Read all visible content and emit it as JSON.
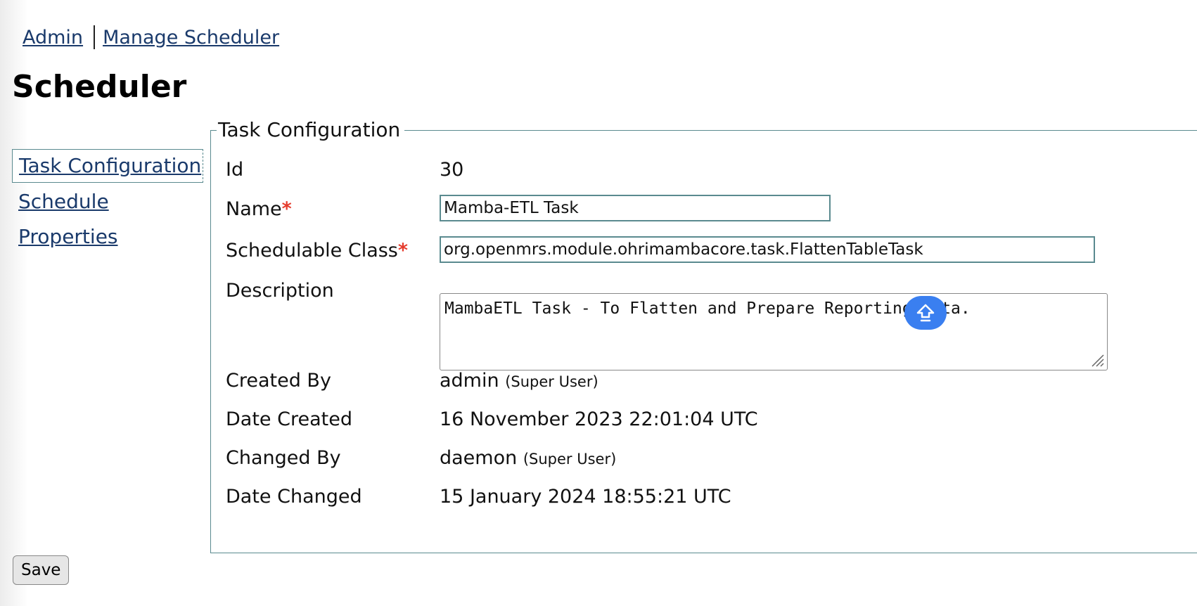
{
  "breadcrumb": {
    "admin": "Admin",
    "manage_scheduler": "Manage Scheduler"
  },
  "page": {
    "title": "Scheduler"
  },
  "side_nav": {
    "items": [
      {
        "label": "Task Configuration",
        "active": true
      },
      {
        "label": "Schedule",
        "active": false
      },
      {
        "label": "Properties",
        "active": false
      }
    ]
  },
  "panel": {
    "legend": "Task Configuration",
    "required_marker": "*",
    "id": {
      "label": "Id",
      "value": "30"
    },
    "name": {
      "label": "Name",
      "value": "Mamba-ETL Task"
    },
    "schedulable_class": {
      "label": "Schedulable Class",
      "value": "org.openmrs.module.ohrimambacore.task.FlattenTableTask"
    },
    "description": {
      "label": "Description",
      "value": "MambaETL Task - To Flatten and Prepare Reporting Data."
    },
    "created_by": {
      "label": "Created By",
      "value": "admin",
      "role": "(Super User)"
    },
    "date_created": {
      "label": "Date Created",
      "value": "16 November 2023 22:01:04 UTC"
    },
    "changed_by": {
      "label": "Changed By",
      "value": "daemon",
      "role": "(Super User)"
    },
    "date_changed": {
      "label": "Date Changed",
      "value": "15 January 2024 18:55:21 UTC"
    }
  },
  "actions": {
    "save_label": "Save"
  },
  "icons": {
    "floating_button": "upload-arrow-icon",
    "resize_grip": "resize-grip-icon"
  },
  "colors": {
    "link": "#1a3a6b",
    "required": "#e53b2c",
    "panel_border": "#5a8a8f",
    "floating_button": "#3a7ff0"
  }
}
